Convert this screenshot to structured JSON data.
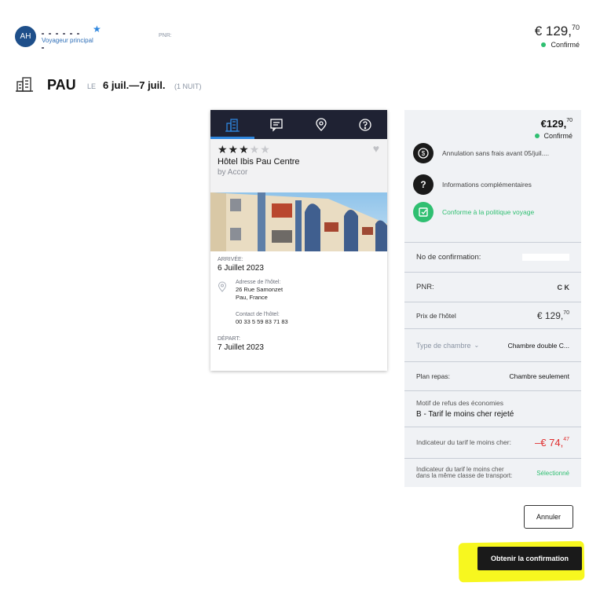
{
  "traveler": {
    "initials": "AH",
    "role": "Voyageur principal",
    "pnr_label": "PNR:",
    "star_icon": "star-icon"
  },
  "header": {
    "price_currency": "€",
    "price_main": "129,",
    "price_cents": "70",
    "status": "Confirmé"
  },
  "trip": {
    "city": "PAU",
    "date_prefix": "LE",
    "dates": "6 juil.—7 juil.",
    "nights": "(1 NUIT)"
  },
  "hotel": {
    "stars_rating": 3,
    "stars_max": 5,
    "name": "Hôtel Ibis Pau Centre",
    "brand": "by Accor",
    "arrival_label": "ARRIVÉE:",
    "arrival_date": "6 Juillet 2023",
    "address_label": "Adresse de l'hôtel:",
    "address_line1": "26 Rue Samonzet",
    "address_line2": "Pau, France",
    "contact_label": "Contact de l'hôtel:",
    "contact_phone": "00 33 5 59 83 71 83",
    "departure_label": "DÉPART:",
    "departure_date": "7 Juillet 2023",
    "tab_icons": [
      "building-icon",
      "message-icon",
      "location-pin-icon",
      "help-icon"
    ]
  },
  "panel": {
    "price_currency": "€",
    "price_main": "129,",
    "price_cents": "70",
    "status": "Confirmé",
    "cancellation": "Annulation sans frais avant 05/juil....",
    "more_info": "Informations complémentaires",
    "policy": "Conforme à la politique voyage",
    "confirmation_no_label": "No de confirmation:",
    "pnr_label": "PNR:",
    "pnr_partial": "C        K",
    "hotel_price_label": "Prix de l'hôtel",
    "hotel_price_currency": "€",
    "hotel_price_main": "129,",
    "hotel_price_cents": "70",
    "room_type_label": "Type de chambre",
    "room_type_value": "Chambre double C...",
    "meal_plan_label": "Plan repas:",
    "meal_plan_value": "Chambre seulement",
    "refusal_reason_label": "Motif de refus des économies",
    "refusal_reason_value": "B - Tarif le moins cher rejeté",
    "lowest_fare_label": "Indicateur du tarif le moins cher:",
    "lowest_fare_value_main": "–€ 74,",
    "lowest_fare_value_cents": "47",
    "lowest_class_label": "Indicateur du tarif le moins cher dans la même classe de transport:",
    "lowest_class_value": "Sélectionné"
  },
  "buttons": {
    "cancel": "Annuler",
    "get_confirmation": "Obtenir la confirmation"
  },
  "colors": {
    "accent_blue": "#2e86de",
    "confirmed_green": "#2fbf71",
    "negative_red": "#e02d2d",
    "highlight_yellow": "#f7f71f",
    "tab_bar": "#1f2233"
  }
}
